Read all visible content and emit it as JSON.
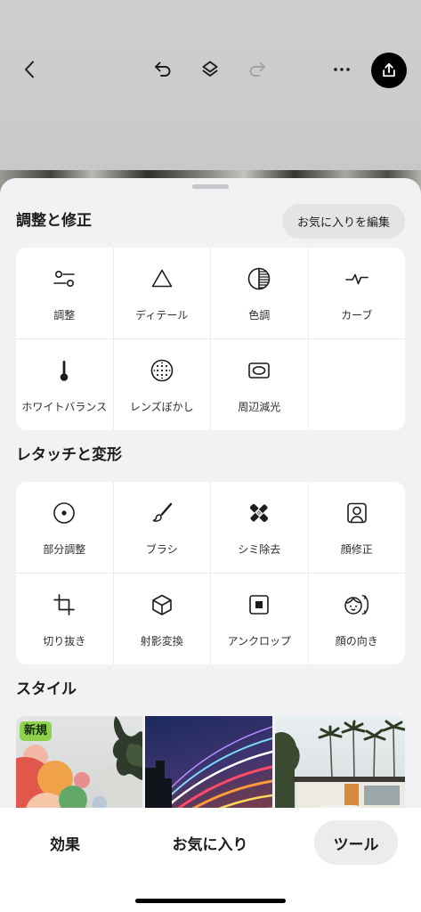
{
  "toolbar": {
    "back_icon": "chevron-left-icon",
    "undo_icon": "undo-icon",
    "layers_icon": "layers-icon",
    "redo_icon": "redo-icon",
    "redo_enabled": false,
    "more_icon": "ellipsis-icon",
    "export_icon": "export-icon"
  },
  "sections": [
    {
      "title": "調整と修正",
      "action_label": "お気に入りを編集",
      "tools": [
        {
          "label": "調整",
          "icon": "sliders-icon"
        },
        {
          "label": "ディテール",
          "icon": "triangle-icon"
        },
        {
          "label": "色調",
          "icon": "tone-circle-icon"
        },
        {
          "label": "カーブ",
          "icon": "curve-line-icon"
        },
        {
          "label": "ホワイトバランス",
          "icon": "thermometer-icon"
        },
        {
          "label": "レンズぼかし",
          "icon": "dotted-circle-icon"
        },
        {
          "label": "周辺減光",
          "icon": "vignette-icon"
        }
      ]
    },
    {
      "title": "レタッチと変形",
      "tools": [
        {
          "label": "部分調整",
          "icon": "target-dot-icon"
        },
        {
          "label": "ブラシ",
          "icon": "brush-icon"
        },
        {
          "label": "シミ除去",
          "icon": "bandage-icon"
        },
        {
          "label": "顔修正",
          "icon": "portrait-icon"
        },
        {
          "label": "切り抜き",
          "icon": "crop-icon"
        },
        {
          "label": "射影変換",
          "icon": "cube-icon"
        },
        {
          "label": "アンクロップ",
          "icon": "uncrop-icon"
        },
        {
          "label": "顔の向き",
          "icon": "face-rotate-icon"
        }
      ]
    }
  ],
  "styles": {
    "title": "スタイル",
    "new_badge": "新規"
  },
  "bottom_tabs": [
    {
      "label": "効果",
      "selected": false
    },
    {
      "label": "お気に入り",
      "selected": false
    },
    {
      "label": "ツール",
      "selected": true
    }
  ],
  "colors": {
    "sheet_background": "#f2f2f5",
    "card_background": "#ffffff",
    "icon": "#1c1c1e",
    "disabled_icon": "#a3a3a3",
    "pill_background": "#e4e4e7",
    "selected_tab_background": "#ececef",
    "new_badge": "#8fd14f",
    "export_button": "#000000"
  }
}
